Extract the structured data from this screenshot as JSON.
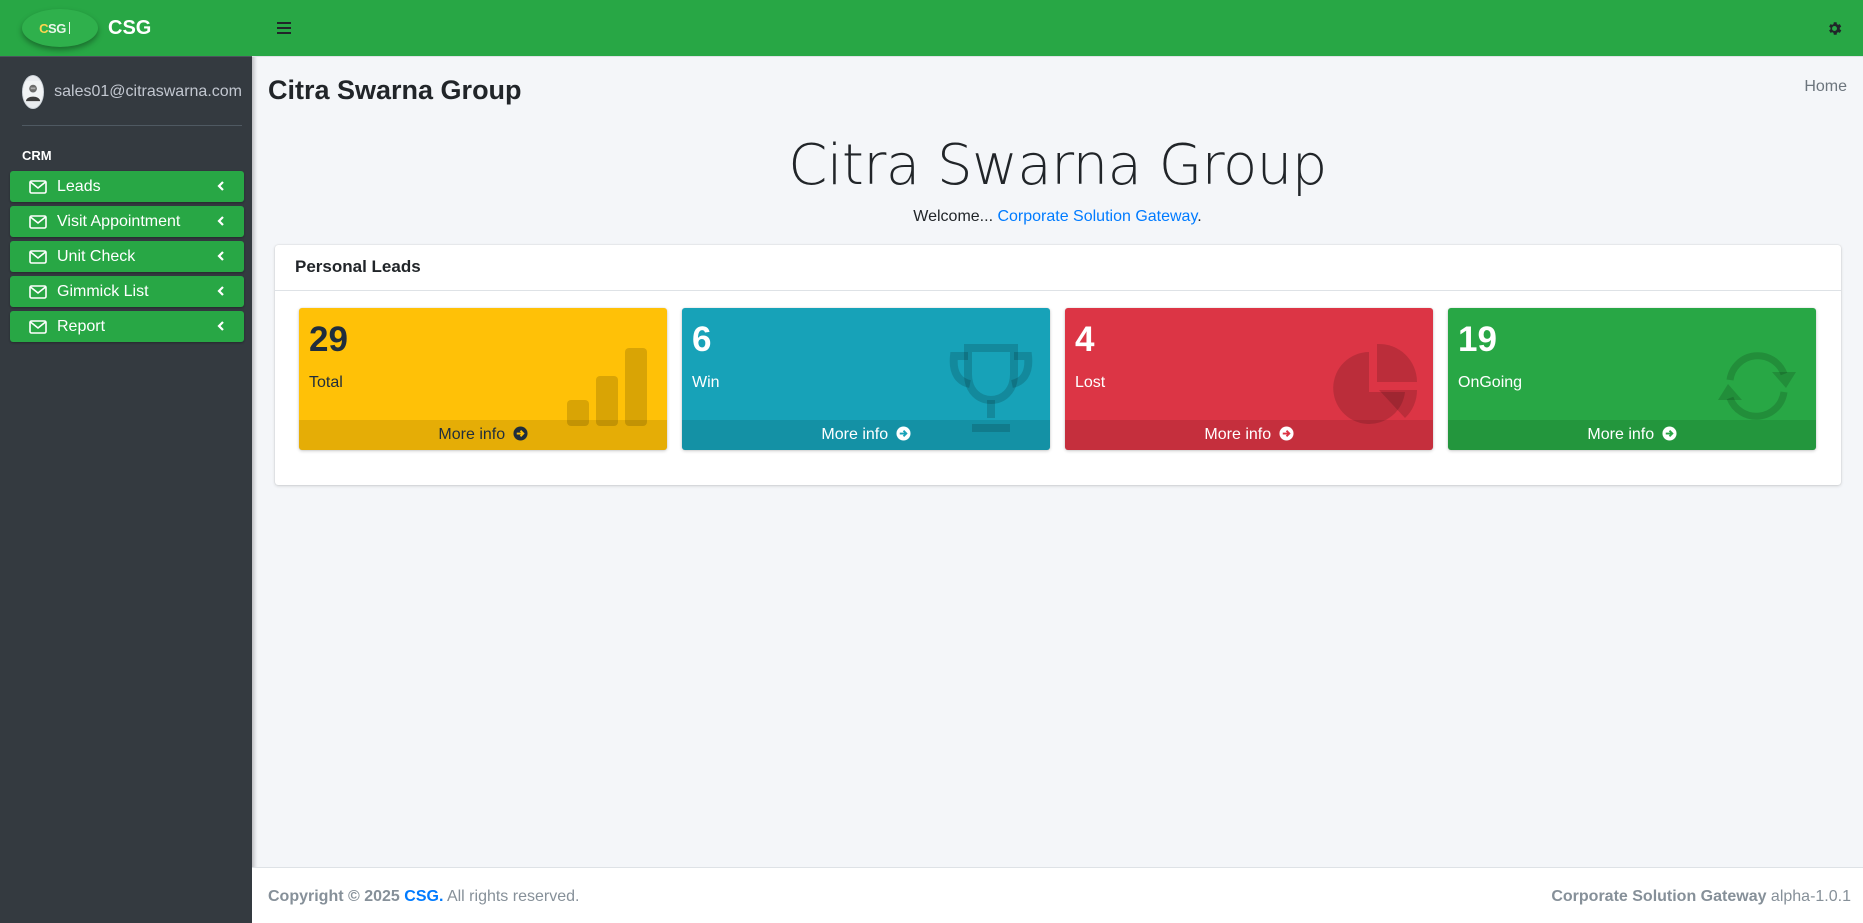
{
  "brand": {
    "logo_text_c": "C",
    "logo_text_sg": "SG",
    "name": "CSG"
  },
  "user": {
    "email": "sales01@citraswarna.com"
  },
  "sidebar": {
    "header": "CRM",
    "items": [
      {
        "label": "Leads"
      },
      {
        "label": "Visit Appointment"
      },
      {
        "label": "Unit Check"
      },
      {
        "label": "Gimmick List"
      },
      {
        "label": "Report"
      }
    ]
  },
  "content": {
    "page_title": "Citra Swarna Group",
    "breadcrumb": "Home",
    "hero_title": "Citra Swarna Group",
    "welcome_prefix": "Welcome... ",
    "welcome_link": "Corporate Solution Gateway",
    "welcome_suffix": "."
  },
  "card": {
    "title": "Personal Leads",
    "boxes": [
      {
        "value": "29",
        "label": "Total",
        "more": "More info",
        "icon": "chart-bar-icon",
        "color": "#ffc107"
      },
      {
        "value": "6",
        "label": "Win",
        "more": "More info",
        "icon": "trophy-icon",
        "color": "#17a2b8"
      },
      {
        "value": "4",
        "label": "Lost",
        "more": "More info",
        "icon": "chart-pie-icon",
        "color": "#dc3545"
      },
      {
        "value": "19",
        "label": "OnGoing",
        "more": "More info",
        "icon": "sync-icon",
        "color": "#28a745"
      }
    ]
  },
  "footer": {
    "copyright": "Copyright © 2025 ",
    "brand": "CSG.",
    "rights": " All rights reserved.",
    "app_name": "Corporate Solution Gateway",
    "version": " alpha-1.0.1"
  },
  "colors": {
    "primary": "#28a745",
    "sidebar": "#343a40",
    "link": "#007bff"
  }
}
